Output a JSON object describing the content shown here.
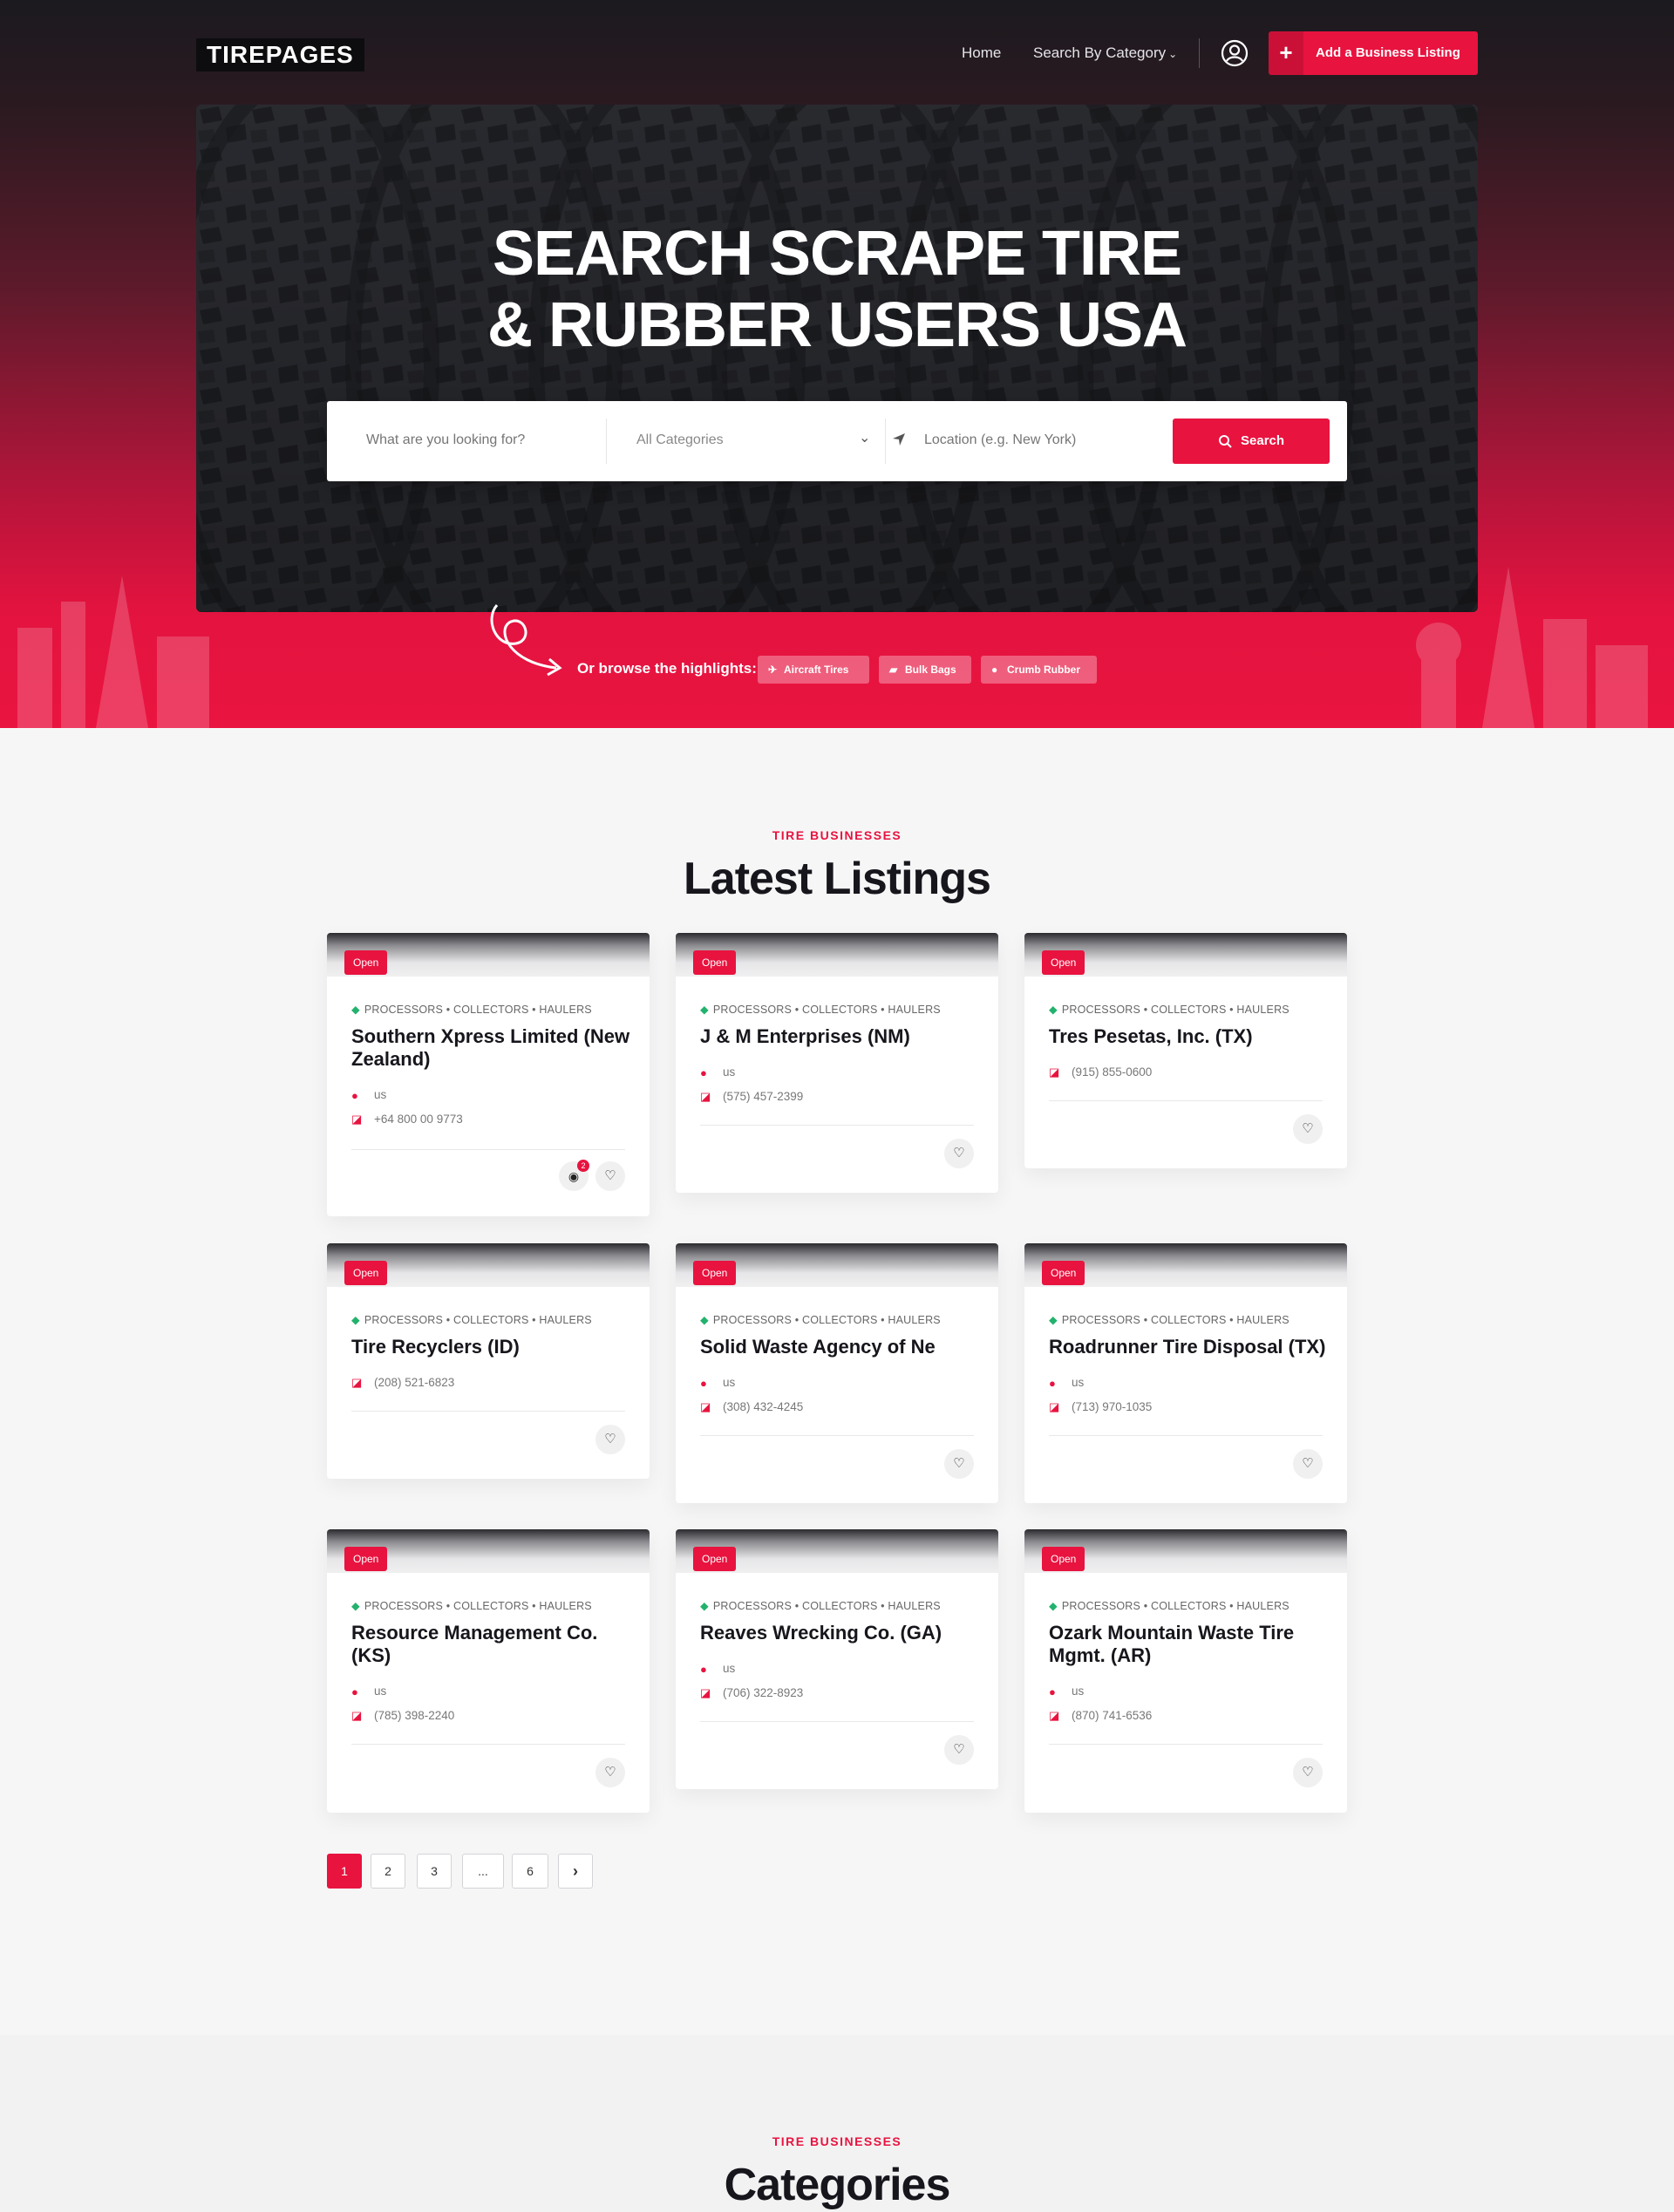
{
  "header": {
    "logo": "TIREPAGES",
    "nav": [
      {
        "label": "Home"
      },
      {
        "label": "Search By Category"
      }
    ],
    "add_listing": "Add a Business Listing"
  },
  "hero": {
    "title_line1": "SEARCH SCRAPE TIRE",
    "title_line2": "& RUBBER USERS USA",
    "search": {
      "what_placeholder": "What are you looking for?",
      "category": "All Categories",
      "location_placeholder": "Location (e.g. New York)",
      "button": "Search"
    },
    "browse_label": "Or browse the highlights:",
    "highlights": [
      {
        "label": "Aircraft Tires",
        "icon": "plane-icon"
      },
      {
        "label": "Bulk Bags",
        "icon": "bag-icon"
      },
      {
        "label": "Crumb Rubber",
        "icon": "pin-icon"
      }
    ]
  },
  "listings_section": {
    "kicker": "TIRE BUSINESSES",
    "title": "Latest Listings",
    "cards": [
      {
        "status": "Open",
        "categories": "PROCESSORS • COLLECTORS • HAULERS",
        "name": "Southern Xpress Limited (New Zealand)",
        "location": "us",
        "phone": "+64 800 00 9773",
        "photos": "2"
      },
      {
        "status": "Open",
        "categories": "PROCESSORS • COLLECTORS • HAULERS",
        "name": "J & M Enterprises (NM)",
        "location": "us",
        "phone": "(575) 457-2399"
      },
      {
        "status": "Open",
        "categories": "PROCESSORS • COLLECTORS • HAULERS",
        "name": "Tres Pesetas, Inc. (TX)",
        "phone": "(915) 855-0600"
      },
      {
        "status": "Open",
        "categories": "PROCESSORS • COLLECTORS • HAULERS",
        "name": "Tire Recyclers (ID)",
        "phone": "(208) 521-6823"
      },
      {
        "status": "Open",
        "categories": "PROCESSORS • COLLECTORS • HAULERS",
        "name": "Solid Waste Agency of Ne",
        "location": "us",
        "phone": "(308) 432-4245"
      },
      {
        "status": "Open",
        "categories": "PROCESSORS • COLLECTORS • HAULERS",
        "name": "Roadrunner Tire Disposal (TX)",
        "location": "us",
        "phone": "(713) 970-1035"
      },
      {
        "status": "Open",
        "categories": "PROCESSORS • COLLECTORS • HAULERS",
        "name": "Resource Management Co. (KS)",
        "location": "us",
        "phone": "(785) 398-2240"
      },
      {
        "status": "Open",
        "categories": "PROCESSORS • COLLECTORS • HAULERS",
        "name": "Reaves Wrecking Co. (GA)",
        "location": "us",
        "phone": "(706) 322-8923"
      },
      {
        "status": "Open",
        "categories": "PROCESSORS • COLLECTORS • HAULERS",
        "name": "Ozark Mountain Waste Tire Mgmt. (AR)",
        "location": "us",
        "phone": "(870) 741-6536"
      }
    ]
  },
  "pagination": {
    "pages": [
      "1",
      "2",
      "3",
      "...",
      "6"
    ],
    "current": "1",
    "next": "›"
  },
  "categories_section": {
    "kicker": "TIRE BUSINESSES",
    "title": "Categories"
  },
  "colors": {
    "accent": "#e8133f",
    "tag_green": "#23b26d",
    "dark": "#16161c"
  }
}
